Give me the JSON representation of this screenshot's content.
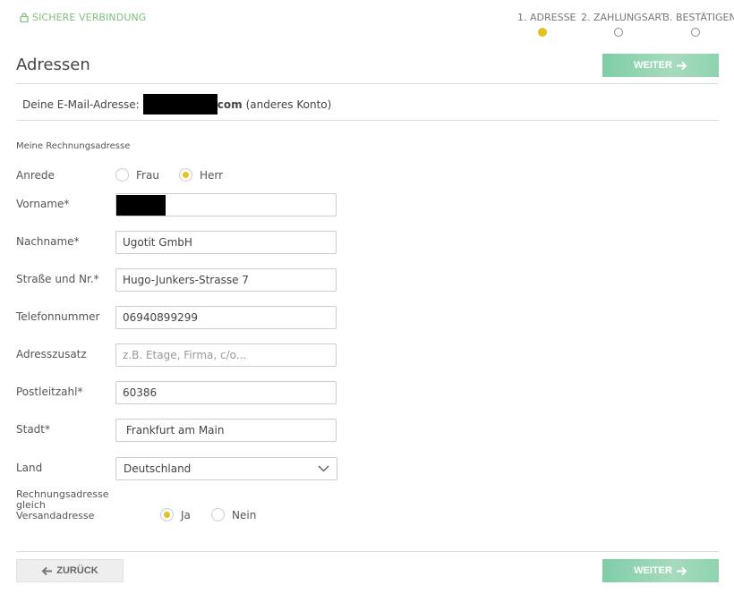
{
  "header": {
    "secure_label": "SICHERE VERBINDUNG",
    "steps": [
      {
        "label": "1. ADRESSE",
        "active": true
      },
      {
        "label": "2. ZAHLUNGSART",
        "active": false
      },
      {
        "label": "3. BESTÄTIGEN",
        "active": false
      }
    ]
  },
  "page_title": "Adressen",
  "buttons": {
    "weiter_label": "WEITER",
    "back_label": "ZURÜCK"
  },
  "email": {
    "prefix": "Deine E-Mail-Adresse:",
    "suffix_bold": "com",
    "other_account": "(anderes Konto)"
  },
  "form": {
    "section_title": "Meine Rechnungsadresse",
    "salutation": {
      "label": "Anrede",
      "options": [
        "Frau",
        "Herr"
      ],
      "selected": "Herr"
    },
    "fields": {
      "first_name": {
        "label": "Vorname*",
        "value": ""
      },
      "last_name": {
        "label": "Nachname*",
        "value": "Ugotit GmbH"
      },
      "street": {
        "label": "Straße und Nr.*",
        "value": "Hugo-Junkers-Strasse 7"
      },
      "phone": {
        "label": "Telefonnummer",
        "value": "06940899299"
      },
      "address_extra": {
        "label": "Adresszusatz",
        "value": "",
        "placeholder": "z.B. Etage, Firma, c/o..."
      },
      "zip": {
        "label": "Postleitzahl*",
        "value": "60386"
      },
      "city": {
        "label": "Stadt*",
        "value": " Frankfurt am Main"
      }
    },
    "country": {
      "label": "Land",
      "value": "Deutschland"
    },
    "same_shipping": {
      "label": "Rechnungsadresse gleich Versandadresse",
      "options": [
        "Ja",
        "Nein"
      ],
      "selected": "Ja"
    }
  },
  "colors": {
    "accent_yellow": "#e5c21e",
    "secure_green": "#7fbf7f",
    "button_green": "#8ed3b0"
  }
}
